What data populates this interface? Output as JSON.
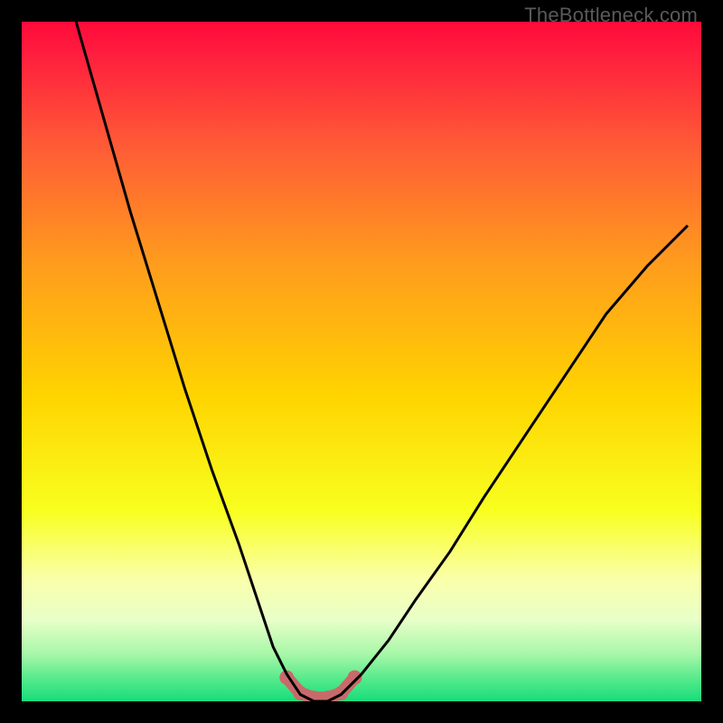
{
  "watermark": "TheBottleneck.com",
  "chart_data": {
    "type": "line",
    "title": "",
    "xlabel": "",
    "ylabel": "",
    "xlim": [
      0,
      100
    ],
    "ylim": [
      0,
      100
    ],
    "series": [
      {
        "name": "bottleneck-curve",
        "x": [
          8,
          12,
          16,
          20,
          24,
          28,
          32,
          35,
          37,
          39,
          41,
          43,
          45,
          47,
          50,
          54,
          58,
          63,
          68,
          74,
          80,
          86,
          92,
          98
        ],
        "values": [
          100,
          86,
          72,
          59,
          46,
          34,
          23,
          14,
          8,
          4,
          1,
          0,
          0,
          1,
          4,
          9,
          15,
          22,
          30,
          39,
          48,
          57,
          64,
          70
        ]
      },
      {
        "name": "optimal-band",
        "x": [
          39,
          41,
          43,
          45,
          47,
          49
        ],
        "values": [
          3.5,
          1.2,
          0.5,
          0.5,
          1.2,
          3.5
        ]
      }
    ],
    "gradient_bands": [
      {
        "stop": 0.0,
        "color": "#ff0a3a"
      },
      {
        "stop": 0.05,
        "color": "#ff1f3e"
      },
      {
        "stop": 0.18,
        "color": "#ff5a36"
      },
      {
        "stop": 0.35,
        "color": "#ff9a1e"
      },
      {
        "stop": 0.55,
        "color": "#ffd400"
      },
      {
        "stop": 0.72,
        "color": "#f8ff1f"
      },
      {
        "stop": 0.82,
        "color": "#faffaa"
      },
      {
        "stop": 0.88,
        "color": "#e8ffc8"
      },
      {
        "stop": 0.93,
        "color": "#a8f7a8"
      },
      {
        "stop": 0.97,
        "color": "#4fe98a"
      },
      {
        "stop": 1.0,
        "color": "#18dc7a"
      }
    ],
    "colors": {
      "curve": "#000000",
      "optimal_band": "#c96a6a"
    }
  }
}
